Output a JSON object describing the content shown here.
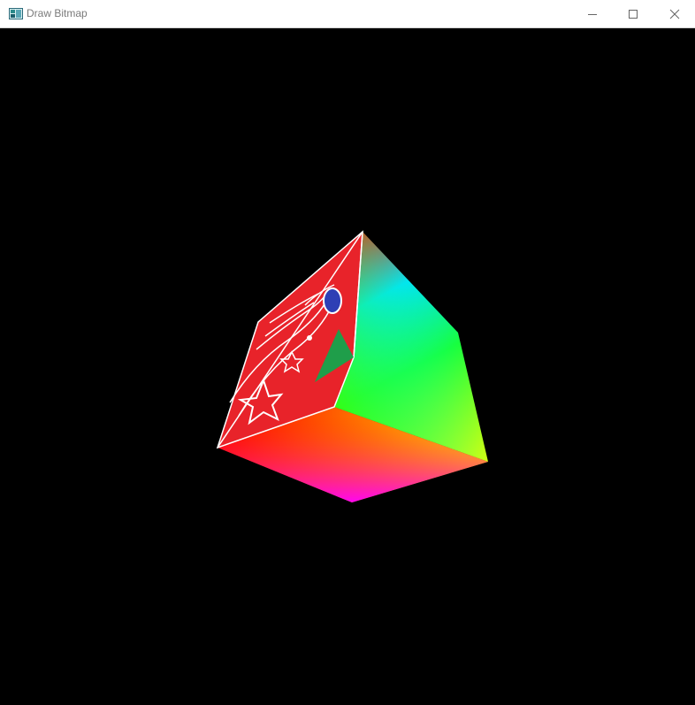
{
  "window": {
    "title": "Draw Bitmap",
    "controls": {
      "minimize_icon": "minimize-icon",
      "maximize_icon": "maximize-icon",
      "close_icon": "close-icon"
    }
  },
  "scene": {
    "background": "#000000",
    "object": "rotating-textured-cube",
    "texture_face": {
      "background": "#e8232a",
      "accent_blue": "#2e3fb5",
      "accent_green": "#1f9e4a",
      "outline": "#ffffff"
    },
    "gradient_colors": [
      "#ff0000",
      "#ff8c00",
      "#ffff00",
      "#00ff00",
      "#00ffff",
      "#ff00ff"
    ]
  }
}
